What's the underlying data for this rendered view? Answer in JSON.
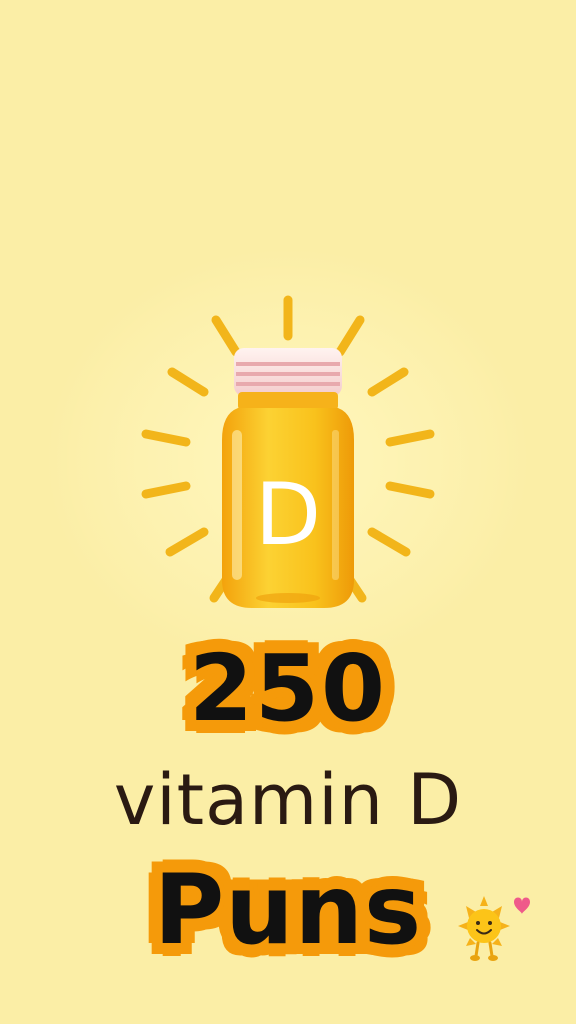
{
  "title": {
    "number": "250",
    "subtitle": "vitamin D",
    "word": "Puns"
  },
  "illustration": {
    "bottle_label": "D",
    "icon": "vitamin-bottle-icon",
    "colors": {
      "background": "#fbeea6",
      "bottle": "#f7b80a",
      "cap": "#f7d3d3",
      "rays": "#f2b51a",
      "outline": "#f59a0a"
    }
  },
  "decoration": {
    "icon": "smiling-sun-heart-icon"
  }
}
